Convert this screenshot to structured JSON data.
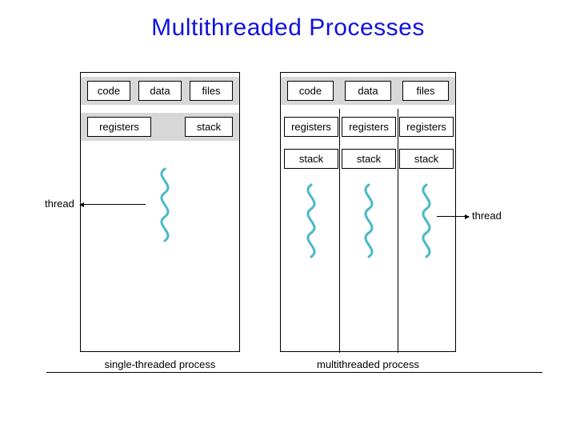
{
  "title": "Multithreaded Processes",
  "labels": {
    "code": "code",
    "data": "data",
    "files": "files",
    "registers": "registers",
    "stack": "stack",
    "thread": "thread"
  },
  "captions": {
    "single": "single-threaded process",
    "multi": "multithreaded process"
  },
  "colors": {
    "title": "#1111dd",
    "squiggle": "#49b8c8"
  }
}
